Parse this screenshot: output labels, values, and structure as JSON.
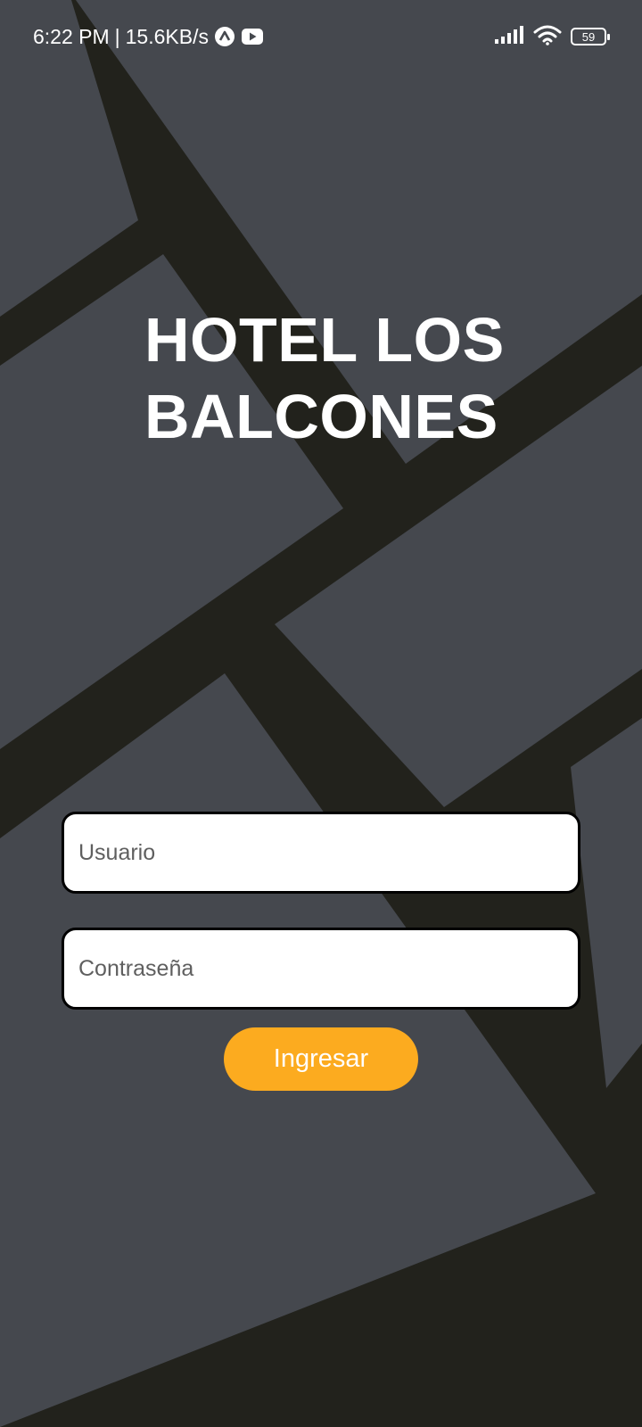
{
  "status_bar": {
    "time": "6:22 PM",
    "separator": "|",
    "network_speed": "15.6KB/s",
    "battery_level": "59",
    "icons": [
      "notification-a-icon",
      "youtube-icon",
      "signal-icon",
      "wifi-icon",
      "battery-icon"
    ]
  },
  "app": {
    "title_line1": "HOTEL LOS",
    "title_line2": "BALCONES"
  },
  "login_form": {
    "username_placeholder": "Usuario",
    "username_value": "",
    "password_placeholder": "Contraseña",
    "password_value": "",
    "submit_label": "Ingresar"
  },
  "colors": {
    "background_dark": "#22221c",
    "panel_gray": "#45484e",
    "accent": "#fcab1f",
    "text_white": "#ffffff"
  }
}
